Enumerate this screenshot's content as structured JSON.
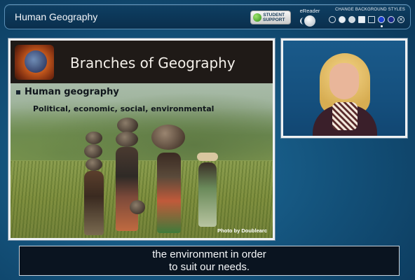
{
  "header": {
    "title": "Human Geography",
    "student_support": [
      "STUDENT",
      "SUPPORT"
    ],
    "ereader_label": "eReader",
    "bg_styles_label": "CHANGE BACKGROUND STYLES",
    "swatches": [
      {
        "icon": "circle-white-outline-icon",
        "color": "#0e3f63"
      },
      {
        "icon": "circle-white-icon",
        "color": "#e8eef4"
      },
      {
        "icon": "circle-light-icon",
        "color": "#cfd8df"
      },
      {
        "icon": "square-white-icon",
        "color": "#e8eef4"
      },
      {
        "icon": "square-outline-icon",
        "color": "#0e3f63"
      },
      {
        "icon": "circle-blue-icon",
        "color": "#1b3fd0"
      },
      {
        "icon": "circle-navy-icon",
        "color": "#1a2a8a"
      },
      {
        "icon": "close-icon",
        "color": "#0e3f63"
      }
    ]
  },
  "slide": {
    "title": "Branches of Geography",
    "bullet": "Human geography",
    "subbullet": "Political, economic, social, environmental",
    "credit": "Photo by Doublearc"
  },
  "caption": {
    "line1": "the environment in order",
    "line2": "to suit our needs."
  },
  "colors": {
    "accent": "#124e76",
    "header_bg": "#0e3f63",
    "caption_bg": "#0a1420"
  }
}
